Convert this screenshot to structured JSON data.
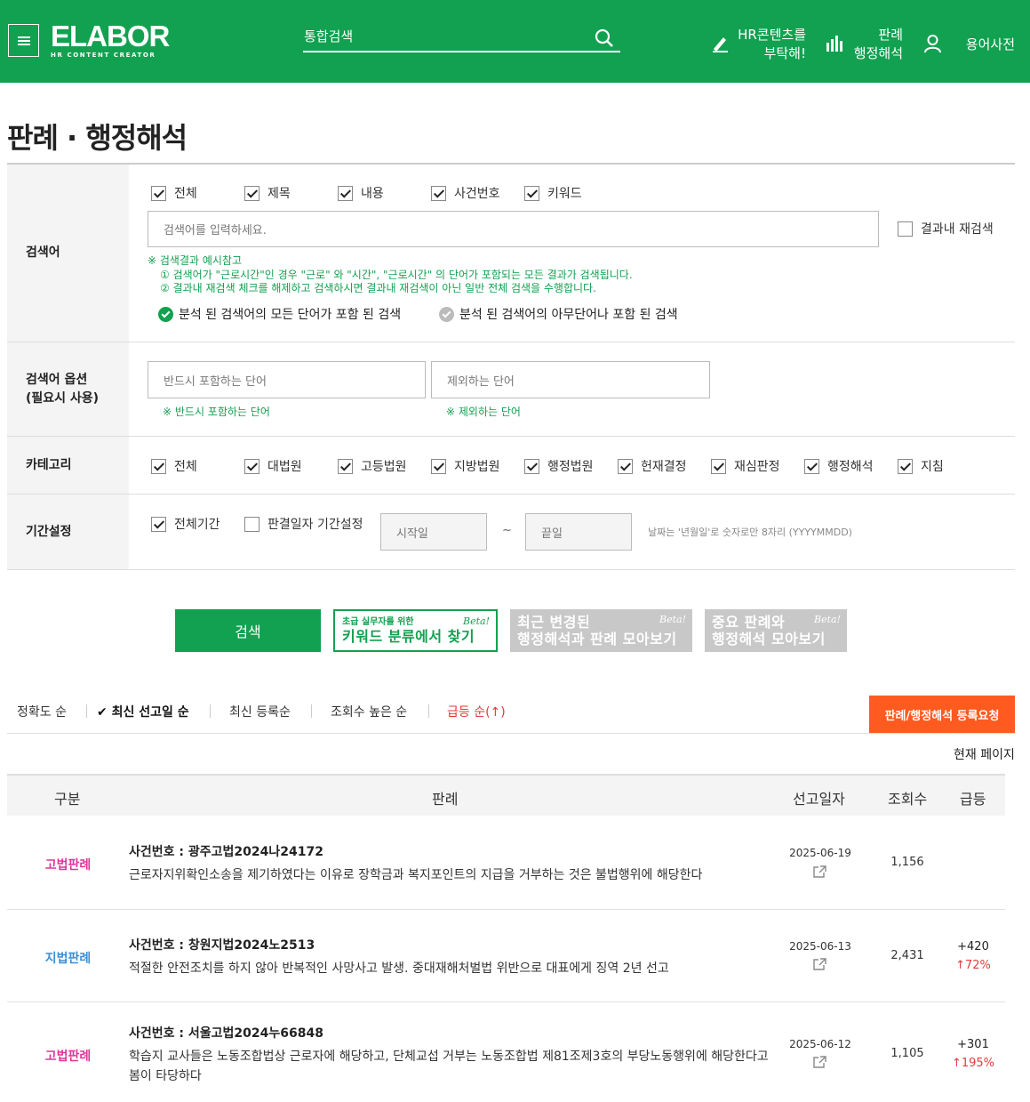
{
  "header": {
    "logo": "ELABOR",
    "logo_sub": "HR CONTENT CREATOR",
    "search_label": "통합검색",
    "request_line1": "HR콘텐츠를",
    "request_line2": "부탁해!",
    "cases_line1": "판례",
    "cases_line2": "행정해석",
    "dictionary": "용어사전"
  },
  "page_title": "판례 · 행정해석",
  "search_form": {
    "keyword_label": "검색어",
    "fields": [
      {
        "label": "전체",
        "checked": true
      },
      {
        "label": "제목",
        "checked": true
      },
      {
        "label": "내용",
        "checked": true
      },
      {
        "label": "사건번호",
        "checked": true
      },
      {
        "label": "키워드",
        "checked": true
      }
    ],
    "keyword_placeholder": "검색어를 입력하세요.",
    "research_label": "결과내 재검색",
    "notes": [
      "※ 검색결과 예시참고",
      "① 검색어가 \"근로시간\"인 경우 \"근로\" 와 \"시간\", \"근로시간\" 의 단어가 포함되는 모든 결과가 검색됩니다.",
      "② 결과내 재검색 체크를 해제하고 검색하시면 결과내 재검색이 아닌 일반 전체 검색을 수행합니다."
    ],
    "match_all": "분석 된 검색어의 모든 단어가 포함 된 검색",
    "match_any": "분석 된 검색어의 아무단어나 포함 된 검색",
    "option_label_1": "검색어 옵션",
    "option_label_2": "(필요시 사용)",
    "include_placeholder": "반드시 포함하는 단어",
    "exclude_placeholder": "제외하는 단어",
    "include_note": "※ 반드시 포함하는 단어",
    "exclude_note": "※ 제외하는 단어",
    "category_label": "카테고리",
    "categories": [
      {
        "label": "전체",
        "checked": true
      },
      {
        "label": "대법원",
        "checked": true
      },
      {
        "label": "고등법원",
        "checked": true
      },
      {
        "label": "지방법원",
        "checked": true
      },
      {
        "label": "행정법원",
        "checked": true
      },
      {
        "label": "헌재결정",
        "checked": true
      },
      {
        "label": "재심판정",
        "checked": true
      },
      {
        "label": "행정해석",
        "checked": true
      },
      {
        "label": "지침",
        "checked": true
      }
    ],
    "period_label": "기간설정",
    "all_period": "전체기간",
    "date_range": "판결일자 기간설정",
    "start_placeholder": "시작일",
    "tilde": "~",
    "end_placeholder": "끝일",
    "date_hint": "날짜는 '년월일'로 숫자로만 8자리 (YYYYMMDD)"
  },
  "buttons": {
    "search": "검색",
    "kw_small": "초급 실무자를 위한",
    "kw_big": "키워드 분류에서 찾기",
    "recent_line1": "최근 변경된",
    "recent_line2": "행정해석과 판례 모아보기",
    "important_line1": "중요 판례와",
    "important_line2": "행정해석 모아보기",
    "beta": "Beta!"
  },
  "sort": {
    "accuracy": "정확도 순",
    "latest_decision": "최신 선고일 순",
    "latest_registered": "최신 등록순",
    "views": "조회수 높은 순",
    "rising": "급등 순(↑)",
    "register_request": "판례/행정해석 등록요청",
    "current_page": "현재 페이지"
  },
  "table": {
    "headers": {
      "category": "구분",
      "case": "판례",
      "date": "선고일자",
      "views": "조회수",
      "rise": "급등"
    },
    "rows": [
      {
        "category": "고법판례",
        "case_no": "사건번호 : 광주고법2024나24172",
        "desc": "근로자지위확인소송을 제기하였다는 이유로 장학금과 복지포인트의 지급을 거부하는 것은 불법행위에 해당한다",
        "date": "2025-06-19",
        "views": "1,156",
        "rise": "",
        "rise_pct": ""
      },
      {
        "category": "지법판례",
        "case_no": "사건번호 : 창원지법2024노2513",
        "desc": "적절한 안전조치를 하지 않아 반복적인 사망사고 발생. 중대재해처벌법 위반으로 대표에게 징역 2년 선고",
        "date": "2025-06-13",
        "views": "2,431",
        "rise": "+420",
        "rise_pct": "↑72%"
      },
      {
        "category": "고법판례",
        "case_no": "사건번호 : 서울고법2024누66848",
        "desc": "학습지 교사들은 노동조합법상 근로자에 해당하고, 단체교섭 거부는 노동조합법 제81조제3호의 부당노동행위에 해당한다고 봄이 타당하다",
        "date": "2025-06-12",
        "views": "1,105",
        "rise": "+301",
        "rise_pct": "↑195%"
      }
    ]
  },
  "colors": {
    "brand_green": "#12a150",
    "orange": "#ff5a1f",
    "high_court": "#e0359b",
    "district_court": "#3b8fd6",
    "rise_red": "#e23b3b"
  }
}
